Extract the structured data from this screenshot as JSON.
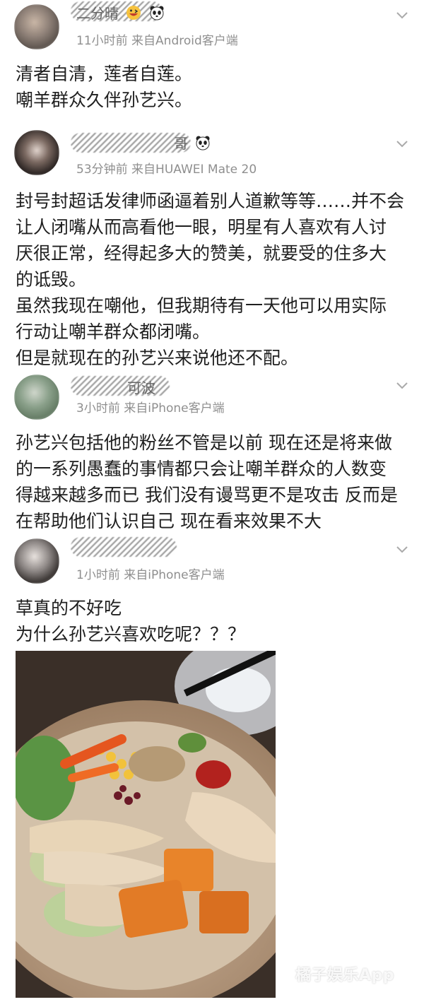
{
  "posts": [
    {
      "name": "二分晴",
      "meta": "11小时前 来自Android客户端",
      "lines": [
        "清者自清，莲者自莲。",
        "嘲羊群众久伴孙艺兴。"
      ]
    },
    {
      "name": "哥",
      "meta": "53分钟前 来自HUAWEI Mate 20",
      "lines": [
        "封号封超话发律师函逼着别人道歉等等……并不会",
        "让人闭嘴从而高看他一眼，明星有人喜欢有人讨",
        "厌很正常，经得起多大的赞美，就要受的住多大",
        "的诋毁。",
        "虽然我现在嘲他，但我期待有一天他可以用实际",
        "行动让嘲羊群众都闭嘴。",
        "但是就现在的孙艺兴来说他还不配。"
      ]
    },
    {
      "name": "可波",
      "meta": "3小时前 来自iPhone客户端",
      "lines": [
        "孙艺兴包括他的粉丝不管是以前 现在还是将来做",
        "的一系列愚蠢的事情都只会让嘲羊群众的人数变",
        "得越来越多而已 我们没有谩骂更不是攻击 反而是",
        "在帮助他们认识自己 现在看来效果不大"
      ]
    },
    {
      "name": "",
      "meta": "1小时前 来自iPhone客户端",
      "lines": [
        "草真的不好吃",
        "为什么孙艺兴喜欢吃呢？？？"
      ]
    }
  ],
  "watermark": "橘子娱乐App",
  "icons": [
    "chevron-down-icon",
    "emoji-grin-icon",
    "panda-icon"
  ]
}
